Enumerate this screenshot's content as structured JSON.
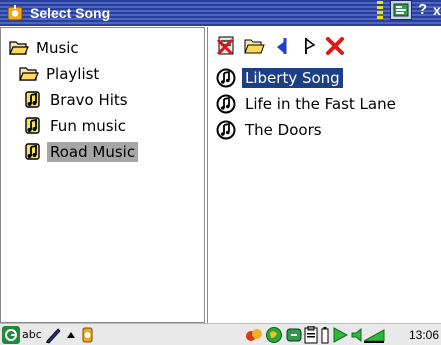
{
  "titlebar": {
    "title": "Select Song",
    "help_label": "?",
    "close_label": "x",
    "colors": {
      "band_dark": "#2a3f9a",
      "band_light": "#4d66c4"
    }
  },
  "folder_tree": {
    "root": "Music",
    "playlist_folder": "Playlist",
    "playlists": [
      "Bravo Hits",
      "Fun music",
      "Road Music"
    ],
    "selected": "Road Music"
  },
  "toolbar_icons": [
    "delete-playlist-icon",
    "open-folder-icon",
    "move-up-icon",
    "play-icon",
    "close-red-icon"
  ],
  "songs": {
    "items": [
      "Liberty Song",
      "Life in the Fast Lane",
      "The Doors"
    ],
    "selected": "Liberty Song",
    "selection_color": "#1d3f86"
  },
  "status": {
    "input_mode": "abc",
    "clock": "13:06"
  }
}
